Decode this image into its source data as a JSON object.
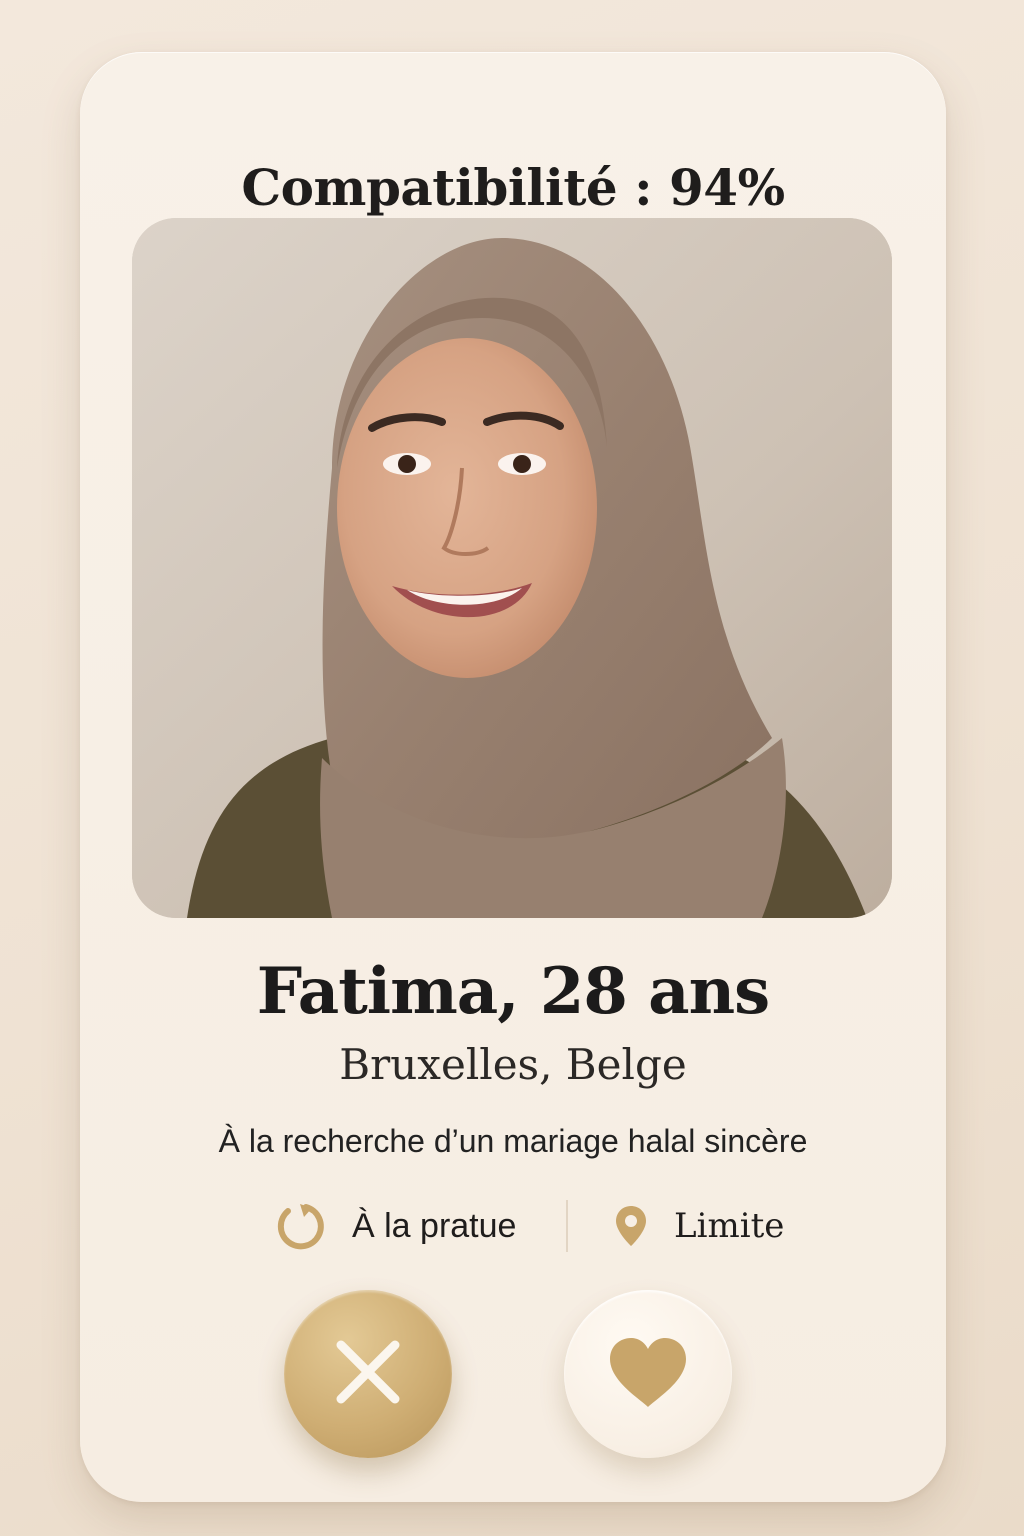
{
  "compatibility": "Compatibilité : 94%",
  "profile": {
    "name_age": "Fatima, 28 ans",
    "location": "Bruxelles, Belge",
    "tagline": "À la recherche d’un mariage halal sincère",
    "practice": "À la pratue",
    "distance": "Limite"
  },
  "icons": {
    "practice": "circular-arrow-icon",
    "distance": "location-pin-icon",
    "reject": "close-icon",
    "like": "heart-icon"
  },
  "colors": {
    "accent_gold": "#c8a56a",
    "card_background": "#f7efe5",
    "text": "#1f1d1c"
  }
}
